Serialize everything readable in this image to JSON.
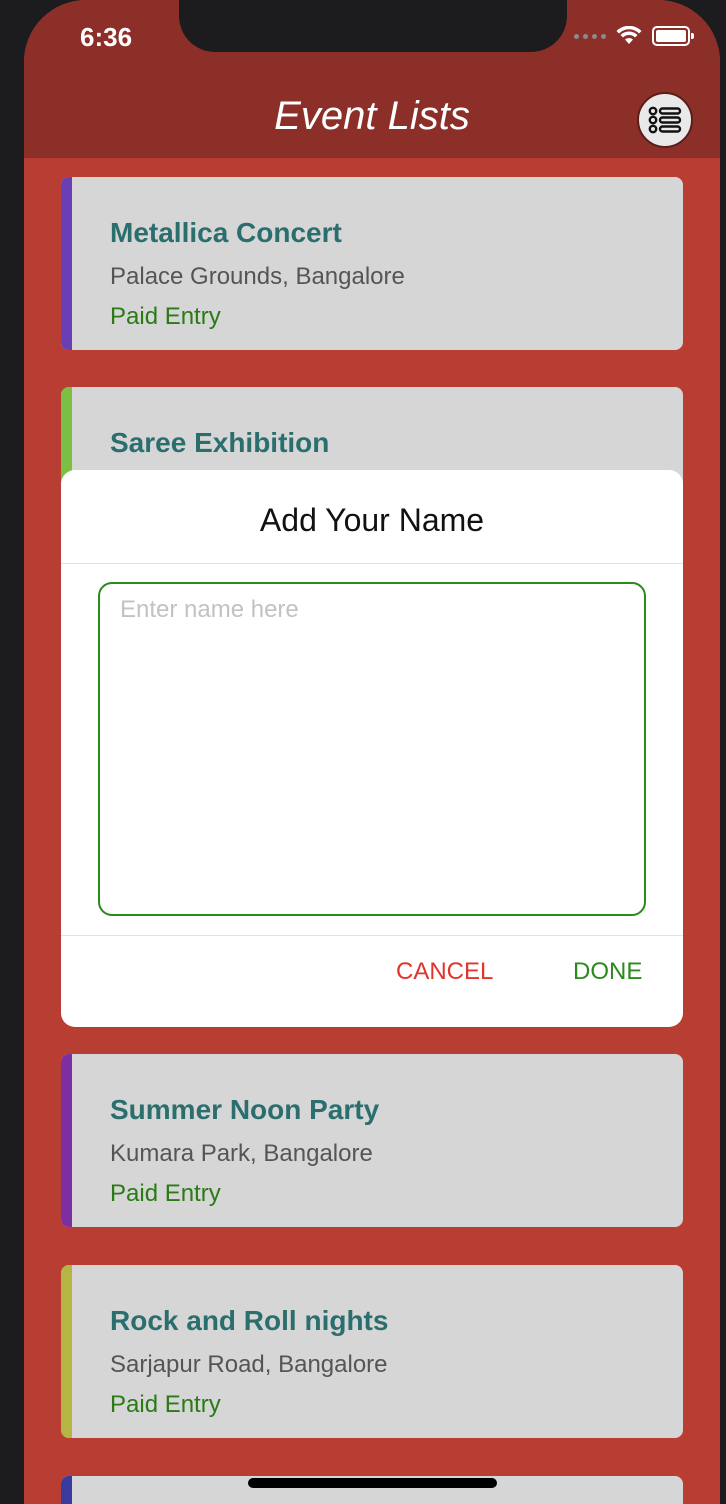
{
  "status_bar": {
    "time": "6:36"
  },
  "header": {
    "title": "Event Lists"
  },
  "events": [
    {
      "name": "Metallica Concert",
      "place": "Palace Grounds, Bangalore",
      "entry": "Paid Entry",
      "color": "#6a3fb5"
    },
    {
      "name": "Saree Exhibition",
      "place": "",
      "entry": "",
      "color": "#7bc043"
    },
    {
      "name": "Summer Noon Party",
      "place": "Kumara Park, Bangalore",
      "entry": "Paid Entry",
      "color": "#7b2fa0"
    },
    {
      "name": "Rock and Roll nights",
      "place": "Sarjapur Road, Bangalore",
      "entry": "Paid Entry",
      "color": "#b5b543"
    }
  ],
  "dialog": {
    "title": "Add Your Name",
    "input_placeholder": "Enter name here",
    "cancel_label": "CANCEL",
    "done_label": "DONE"
  }
}
